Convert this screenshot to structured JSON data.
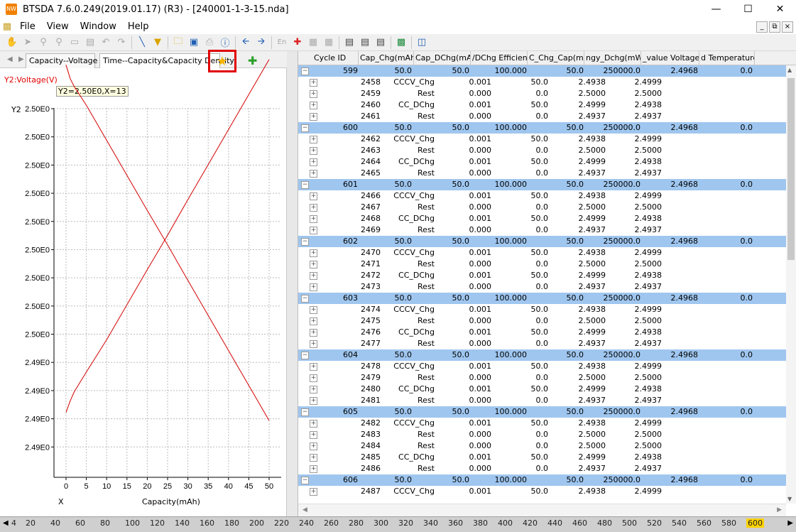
{
  "window": {
    "title": "BTSDA 7.6.0.249(2019.01.17) (R3) - [240001-1-3-15.nda]",
    "app_icon": "btsda-icon"
  },
  "menu": [
    "File",
    "View",
    "Window",
    "Help"
  ],
  "toolbar": [
    "hand-icon",
    "pointer-icon",
    "zoom-in-icon",
    "zoom-out-icon",
    "reset-zoom-icon",
    "pan-icon",
    "undo-icon",
    "redo-icon",
    "line-icon",
    "filter-icon",
    "open-icon",
    "save-icon",
    "print-icon",
    "help-icon",
    "back-icon",
    "forward-icon",
    "english-icon",
    "marker-icon",
    "grid-icon",
    "grid2-icon",
    "table-icon",
    "table2-icon",
    "table3-icon",
    "excel-icon",
    "layout-icon"
  ],
  "tabs": {
    "items": [
      "Capacity--Voltage",
      "Time--Capacity&Capacity Density"
    ],
    "active": 1,
    "highlight_color": "#e00000"
  },
  "chart": {
    "y_label": "Y2:Voltage(V)",
    "y_axis_name": "Y2",
    "tooltip": "Y2=2.50E0,X=13",
    "x_axis_name": "X",
    "x_title": "Capacity(mAh)",
    "y_ticks": [
      "2.50E0",
      "2.50E0",
      "2.50E0",
      "2.50E0",
      "2.50E0",
      "2.50E0",
      "2.50E0",
      "2.50E0",
      "2.50E0",
      "2.49E0",
      "2.49E0",
      "2.49E0",
      "2.49E0"
    ],
    "x_ticks": [
      "0",
      "5",
      "10",
      "15",
      "20",
      "25",
      "30",
      "35",
      "40",
      "45",
      "50"
    ]
  },
  "chart_data": {
    "type": "line",
    "title": "",
    "xlabel": "Capacity(mAh)",
    "ylabel": "Y2:Voltage(V)",
    "xlim": [
      0,
      50
    ],
    "ylim": [
      2.4877,
      2.5013
    ],
    "y_tick_values": [
      2.50029,
      2.49929,
      2.49829,
      2.49729,
      2.49629,
      2.49529,
      2.49429,
      2.49329,
      2.49229,
      2.49129,
      2.49029,
      2.48929
    ],
    "line_color": "#d40000",
    "series": [
      {
        "x": [
          0,
          1,
          2,
          5,
          10,
          15,
          20,
          25,
          30,
          35,
          40,
          45,
          50
        ],
        "y": [
          2.49,
          2.49042,
          2.49076,
          2.4915,
          2.4927,
          2.494,
          2.4953,
          2.49658,
          2.4979,
          2.4992,
          2.5005,
          2.5018,
          2.5031
        ]
      },
      {
        "x": [
          0,
          1,
          2,
          5,
          10,
          15,
          20,
          25,
          30,
          35,
          40,
          45,
          50
        ],
        "y": [
          2.5029,
          2.5024,
          2.5021,
          2.5014,
          2.5001,
          2.4988,
          2.4975,
          2.49622,
          2.4949,
          2.4936,
          2.4923,
          2.491,
          2.4897
        ]
      }
    ]
  },
  "grid": {
    "headers": [
      "Cycle ID",
      "Cap_Chg(mAh)",
      "Cap_DChg(mAh)",
      "/DChg Efficiency",
      "C_Chg_Cap(mAh",
      "ngy_Dchg(mWh",
      "_value Voltage(",
      "d Temperature(°"
    ],
    "cycles": [
      {
        "id": "599",
        "vals": [
          "50.0",
          "50.0",
          "100.000",
          "50.0",
          "250000.0",
          "2.4968",
          "0.0"
        ],
        "steps": [
          [
            "2458",
            "CCCV_Chg",
            "0.001",
            "50.0",
            "2.4938",
            "2.4999"
          ],
          [
            "2459",
            "Rest",
            "0.000",
            "0.0",
            "2.5000",
            "2.5000"
          ],
          [
            "2460",
            "CC_DChg",
            "0.001",
            "50.0",
            "2.4999",
            "2.4938"
          ],
          [
            "2461",
            "Rest",
            "0.000",
            "0.0",
            "2.4937",
            "2.4937"
          ]
        ]
      },
      {
        "id": "600",
        "vals": [
          "50.0",
          "50.0",
          "100.000",
          "50.0",
          "250000.0",
          "2.4968",
          "0.0"
        ],
        "steps": [
          [
            "2462",
            "CCCV_Chg",
            "0.001",
            "50.0",
            "2.4938",
            "2.4999"
          ],
          [
            "2463",
            "Rest",
            "0.000",
            "0.0",
            "2.5000",
            "2.5000"
          ],
          [
            "2464",
            "CC_DChg",
            "0.001",
            "50.0",
            "2.4999",
            "2.4938"
          ],
          [
            "2465",
            "Rest",
            "0.000",
            "0.0",
            "2.4937",
            "2.4937"
          ]
        ]
      },
      {
        "id": "601",
        "vals": [
          "50.0",
          "50.0",
          "100.000",
          "50.0",
          "250000.0",
          "2.4968",
          "0.0"
        ],
        "steps": [
          [
            "2466",
            "CCCV_Chg",
            "0.001",
            "50.0",
            "2.4938",
            "2.4999"
          ],
          [
            "2467",
            "Rest",
            "0.000",
            "0.0",
            "2.5000",
            "2.5000"
          ],
          [
            "2468",
            "CC_DChg",
            "0.001",
            "50.0",
            "2.4999",
            "2.4938"
          ],
          [
            "2469",
            "Rest",
            "0.000",
            "0.0",
            "2.4937",
            "2.4937"
          ]
        ]
      },
      {
        "id": "602",
        "vals": [
          "50.0",
          "50.0",
          "100.000",
          "50.0",
          "250000.0",
          "2.4968",
          "0.0"
        ],
        "steps": [
          [
            "2470",
            "CCCV_Chg",
            "0.001",
            "50.0",
            "2.4938",
            "2.4999"
          ],
          [
            "2471",
            "Rest",
            "0.000",
            "0.0",
            "2.5000",
            "2.5000"
          ],
          [
            "2472",
            "CC_DChg",
            "0.001",
            "50.0",
            "2.4999",
            "2.4938"
          ],
          [
            "2473",
            "Rest",
            "0.000",
            "0.0",
            "2.4937",
            "2.4937"
          ]
        ]
      },
      {
        "id": "603",
        "vals": [
          "50.0",
          "50.0",
          "100.000",
          "50.0",
          "250000.0",
          "2.4968",
          "0.0"
        ],
        "steps": [
          [
            "2474",
            "CCCV_Chg",
            "0.001",
            "50.0",
            "2.4938",
            "2.4999"
          ],
          [
            "2475",
            "Rest",
            "0.000",
            "0.0",
            "2.5000",
            "2.5000"
          ],
          [
            "2476",
            "CC_DChg",
            "0.001",
            "50.0",
            "2.4999",
            "2.4938"
          ],
          [
            "2477",
            "Rest",
            "0.000",
            "0.0",
            "2.4937",
            "2.4937"
          ]
        ]
      },
      {
        "id": "604",
        "vals": [
          "50.0",
          "50.0",
          "100.000",
          "50.0",
          "250000.0",
          "2.4968",
          "0.0"
        ],
        "steps": [
          [
            "2478",
            "CCCV_Chg",
            "0.001",
            "50.0",
            "2.4938",
            "2.4999"
          ],
          [
            "2479",
            "Rest",
            "0.000",
            "0.0",
            "2.5000",
            "2.5000"
          ],
          [
            "2480",
            "CC_DChg",
            "0.001",
            "50.0",
            "2.4999",
            "2.4938"
          ],
          [
            "2481",
            "Rest",
            "0.000",
            "0.0",
            "2.4937",
            "2.4937"
          ]
        ]
      },
      {
        "id": "605",
        "vals": [
          "50.0",
          "50.0",
          "100.000",
          "50.0",
          "250000.0",
          "2.4968",
          "0.0"
        ],
        "steps": [
          [
            "2482",
            "CCCV_Chg",
            "0.001",
            "50.0",
            "2.4938",
            "2.4999"
          ],
          [
            "2483",
            "Rest",
            "0.000",
            "0.0",
            "2.5000",
            "2.5000"
          ],
          [
            "2484",
            "Rest",
            "0.000",
            "0.0",
            "2.5000",
            "2.5000"
          ],
          [
            "2485",
            "CC_DChg",
            "0.001",
            "50.0",
            "2.4999",
            "2.4938"
          ],
          [
            "2486",
            "Rest",
            "0.000",
            "0.0",
            "2.4937",
            "2.4937"
          ]
        ]
      },
      {
        "id": "606",
        "vals": [
          "50.0",
          "50.0",
          "100.000",
          "50.0",
          "250000.0",
          "2.4968",
          "0.0"
        ],
        "steps": [
          [
            "2487",
            "CCCV_Chg",
            "0.001",
            "50.0",
            "2.4938",
            "2.4999"
          ]
        ]
      }
    ],
    "row_highlight": "#9fc6ef"
  },
  "bottom_ruler": {
    "ticks": [
      "4",
      "20",
      "40",
      "60",
      "80",
      "100",
      "120",
      "140",
      "160",
      "180",
      "200",
      "220",
      "240",
      "260",
      "280",
      "300",
      "320",
      "340",
      "360",
      "380",
      "400",
      "420",
      "440",
      "460",
      "480",
      "500",
      "520",
      "540",
      "560",
      "580",
      "600"
    ],
    "selected": "600",
    "selected_color": "#ffd200"
  }
}
